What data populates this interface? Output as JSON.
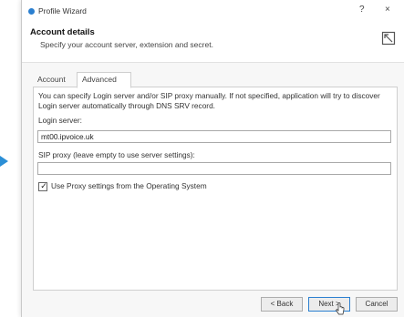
{
  "window": {
    "title": "Profile Wizard",
    "help_symbol": "?",
    "close_symbol": "×"
  },
  "header": {
    "title": "Account details",
    "subtitle": "Specify your account server, extension and secret.",
    "icon": "collapse-icon"
  },
  "tabs": [
    {
      "label": "Account",
      "active": false
    },
    {
      "label": "Advanced",
      "active": true
    }
  ],
  "panel": {
    "info_text": "You can specify Login server and/or SIP proxy manually. If not specified, application will try to discover Login server automatically through DNS SRV record.",
    "login_server_label": "Login server:",
    "login_server_value": "mt00.ipvoice.uk",
    "sip_proxy_label": "SIP proxy (leave empty to use server settings):",
    "sip_proxy_value": "",
    "use_proxy_label": "Use Proxy settings from the Operating System",
    "use_proxy_checked": true
  },
  "buttons": {
    "back": "< Back",
    "next": "Next >",
    "cancel": "Cancel"
  },
  "colors": {
    "accent": "#2b7fd0",
    "pointer_arrow": "#2b8fd6"
  }
}
